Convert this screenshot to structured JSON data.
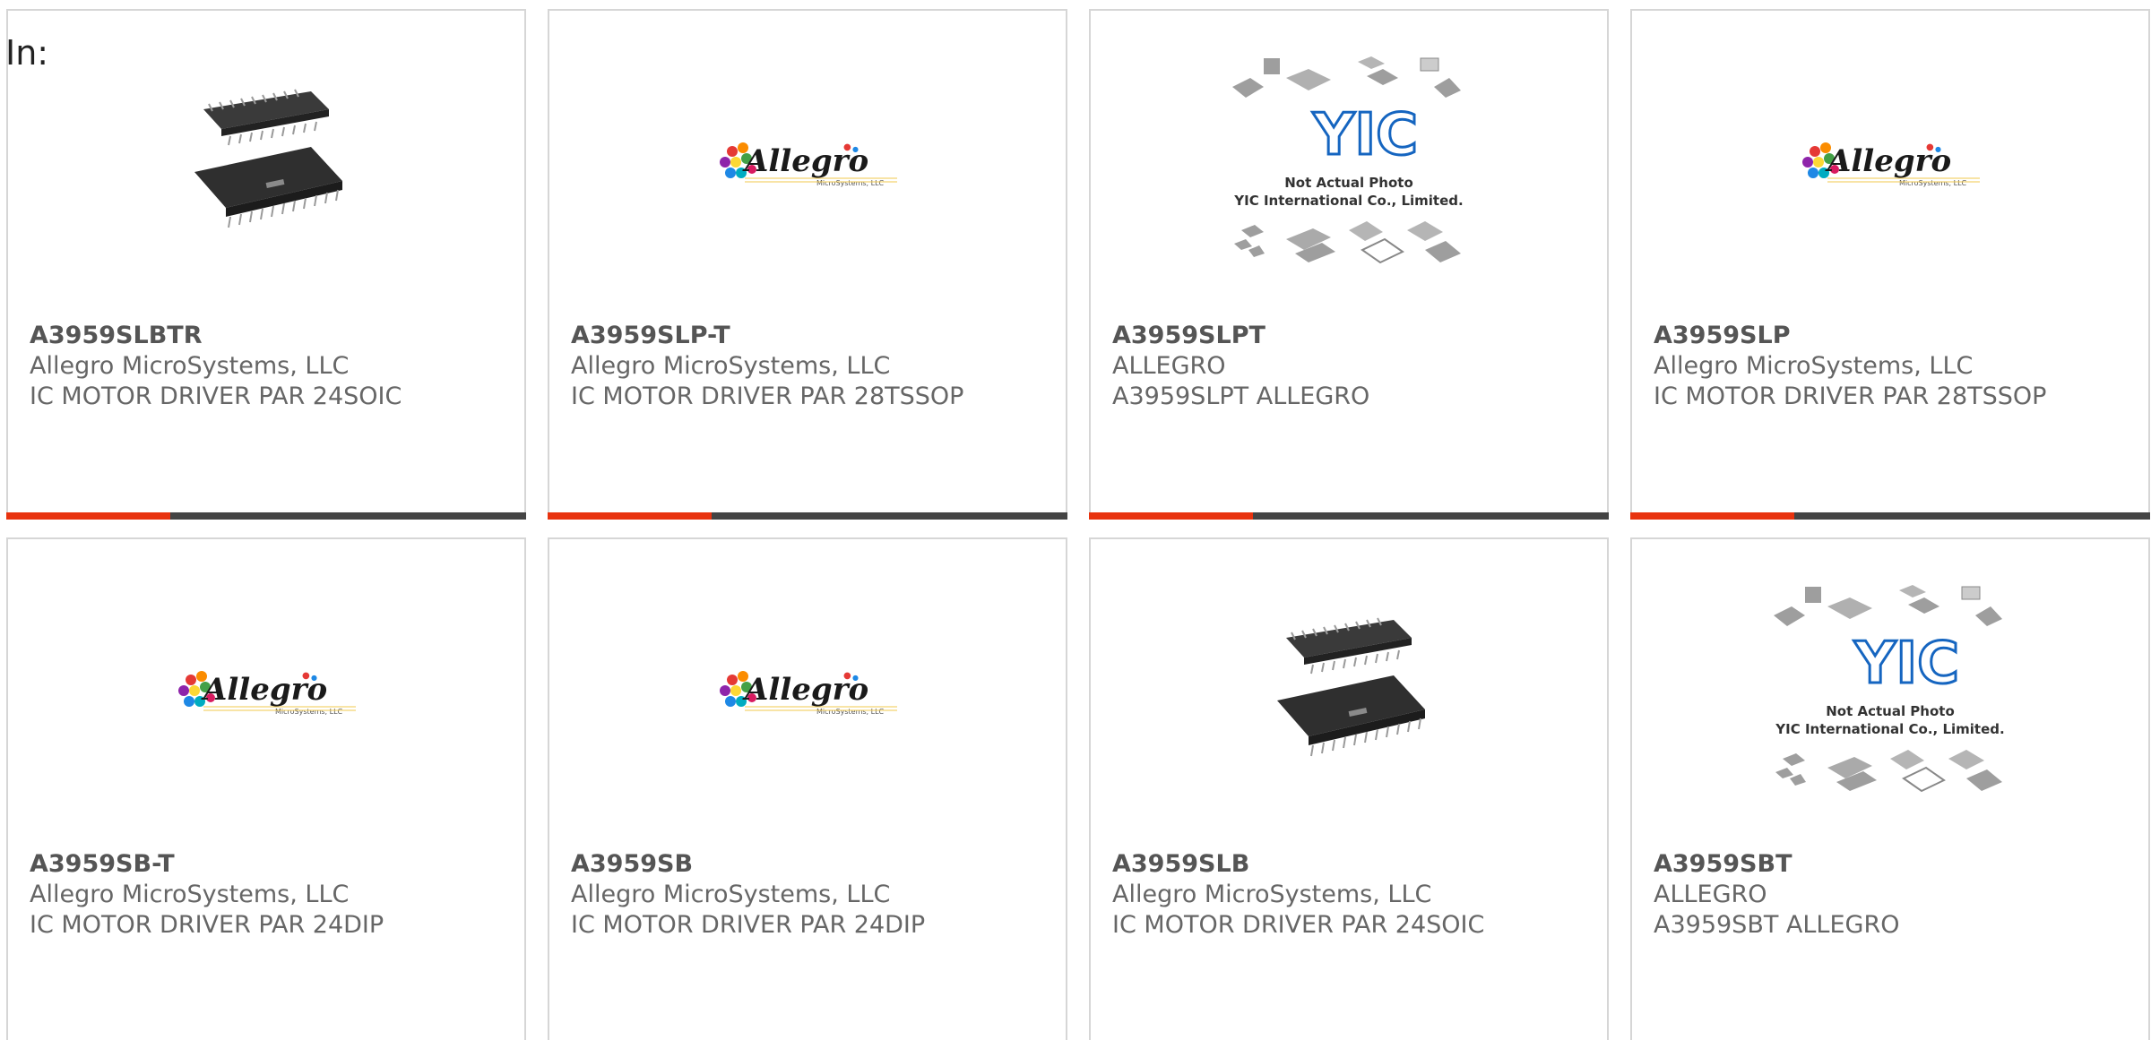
{
  "header": {
    "in_label": "In:"
  },
  "colors": {
    "accent_bar": "#e8330f",
    "bar_dark": "#444444",
    "card_border": "#d6d6d6",
    "text": "#666666"
  },
  "products": [
    {
      "part_number": "A3959SLBTR",
      "manufacturer": "Allegro MicroSystems, LLC",
      "description": "IC MOTOR DRIVER PAR 24SOIC",
      "image": "soic-chip-photo"
    },
    {
      "part_number": "A3959SLP-T",
      "manufacturer": "Allegro MicroSystems, LLC",
      "description": "IC MOTOR DRIVER PAR 28TSSOP",
      "image": "allegro-logo",
      "logo_text": "Allegro",
      "logo_sub": "MicroSystems, LLC"
    },
    {
      "part_number": "A3959SLPT",
      "manufacturer": "ALLEGRO",
      "description": "A3959SLPT ALLEGRO",
      "image": "yic-placeholder",
      "placeholder_lines": [
        "Not Actual Photo",
        "YIC International Co., Limited."
      ]
    },
    {
      "part_number": "A3959SLP",
      "manufacturer": "Allegro MicroSystems, LLC",
      "description": "IC MOTOR DRIVER PAR 28TSSOP",
      "image": "allegro-logo",
      "logo_text": "Allegro",
      "logo_sub": "MicroSystems, LLC"
    },
    {
      "part_number": "A3959SB-T",
      "manufacturer": "Allegro MicroSystems, LLC",
      "description": "IC MOTOR DRIVER PAR 24DIP",
      "image": "allegro-logo",
      "logo_text": "Allegro",
      "logo_sub": "MicroSystems, LLC"
    },
    {
      "part_number": "A3959SB",
      "manufacturer": "Allegro MicroSystems, LLC",
      "description": "IC MOTOR DRIVER PAR 24DIP",
      "image": "allegro-logo",
      "logo_text": "Allegro",
      "logo_sub": "MicroSystems, LLC"
    },
    {
      "part_number": "A3959SLB",
      "manufacturer": "Allegro MicroSystems, LLC",
      "description": "IC MOTOR DRIVER PAR 24SOIC",
      "image": "soic-chip-photo"
    },
    {
      "part_number": "A3959SBT",
      "manufacturer": "ALLEGRO",
      "description": "A3959SBT ALLEGRO",
      "image": "yic-placeholder",
      "placeholder_lines": [
        "Not Actual Photo",
        "YIC International Co., Limited."
      ]
    }
  ]
}
